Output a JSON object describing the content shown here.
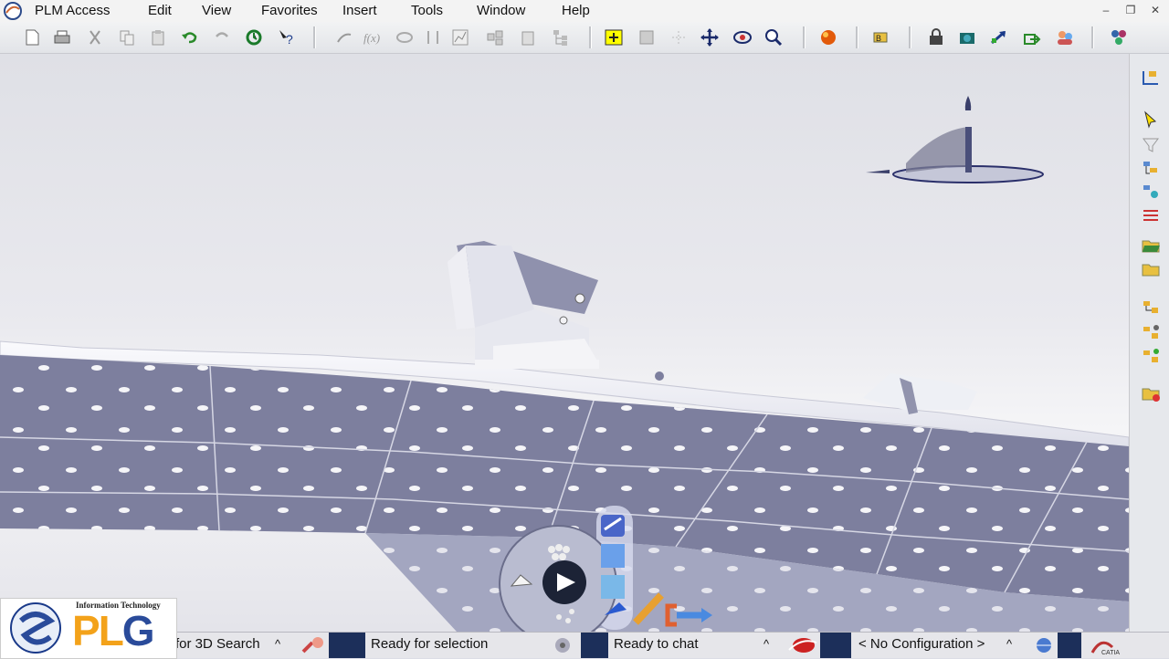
{
  "menubar": {
    "items": [
      "PLM Access",
      "Edit",
      "View",
      "Favorites",
      "Insert",
      "Tools",
      "Window",
      "Help"
    ]
  },
  "toolbar": {
    "icons": [
      "new-icon",
      "print-icon",
      "cut-icon",
      "copy-icon",
      "paste-icon",
      "undo-icon",
      "redo-icon",
      "update-icon",
      "whats-this-icon",
      "formula-icon",
      "function-icon",
      "reaction-icon",
      "measure-icon",
      "graph-icon",
      "catalog-icon",
      "clipboard-icon",
      "tree-icon",
      "fit-all-icon",
      "normal-view-icon",
      "grid-icon",
      "pan-icon",
      "rotate-icon",
      "zoom-icon",
      "render-sphere-icon",
      "knowledge-icon",
      "lock-icon",
      "camera-icon",
      "arrow-link-icon",
      "export-icon",
      "collab-icon",
      "network-icon"
    ]
  },
  "rightbar": {
    "icons": [
      "tree-expand-icon",
      "select-arrow-icon",
      "filter-icon",
      "product-tree-icon",
      "product-settings-icon",
      "assembly-icon",
      "open-folder-icon",
      "folder-icon",
      "component-icon",
      "component-add-icon",
      "component-new-icon",
      "folder-sync-icon"
    ]
  },
  "compass": {
    "label": "compass"
  },
  "robot": {
    "label": "manipulation"
  },
  "status": {
    "search_text": "for 3D Search",
    "selection_text": "Ready for selection",
    "chat_text": "Ready to chat",
    "config_text": "< No Configuration >",
    "caret": "^"
  },
  "logo": {
    "tagline": "Information Technology",
    "word_p": "P",
    "word_l": "L",
    "word_g": "G",
    "ring_text": "Prescient Leading Global"
  },
  "colors": {
    "part": "#7d7f9e",
    "part_light": "#a3a6c0",
    "highlight": "#f5f5f8",
    "plg_orange": "#f3a21a",
    "plg_blue": "#2a4b9a"
  }
}
